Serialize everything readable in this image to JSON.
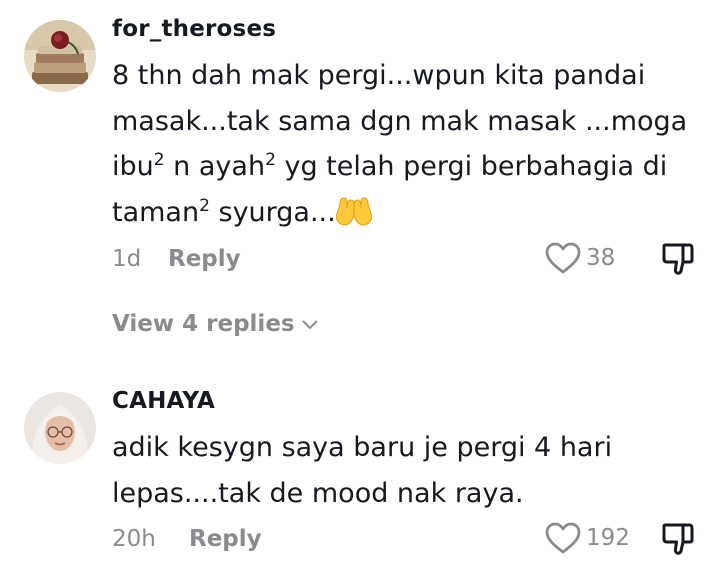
{
  "comments": [
    {
      "username": "for_theroses",
      "text_line1": "8 thn dah mak pergi...wpun kita pandai",
      "text_line2": "masak...tak sama dgn mak masak ...moga",
      "text_part_ibu": "ibu",
      "text_sup1": "2",
      "text_part_n_ayah": " n ayah",
      "text_sup2": "2",
      "text_part_rest3": " yg telah pergi berbahagia di",
      "text_part_taman": "taman",
      "text_sup3": "2",
      "text_part_syurga": " syurga...",
      "emoji_icon": "palms-up-together-emoji",
      "time": "1d",
      "reply_label": "Reply",
      "likes": "38",
      "view_replies_label": "View 4 replies"
    },
    {
      "username": "CAHAYA",
      "text_line1": "adik kesygn saya baru je pergi 4 hari",
      "text_line2": "lepas....tak de mood nak raya.",
      "time": "20h",
      "reply_label": "Reply",
      "likes": "192"
    }
  ],
  "colors": {
    "text": "#161823",
    "secondary": "#8a8b91"
  }
}
